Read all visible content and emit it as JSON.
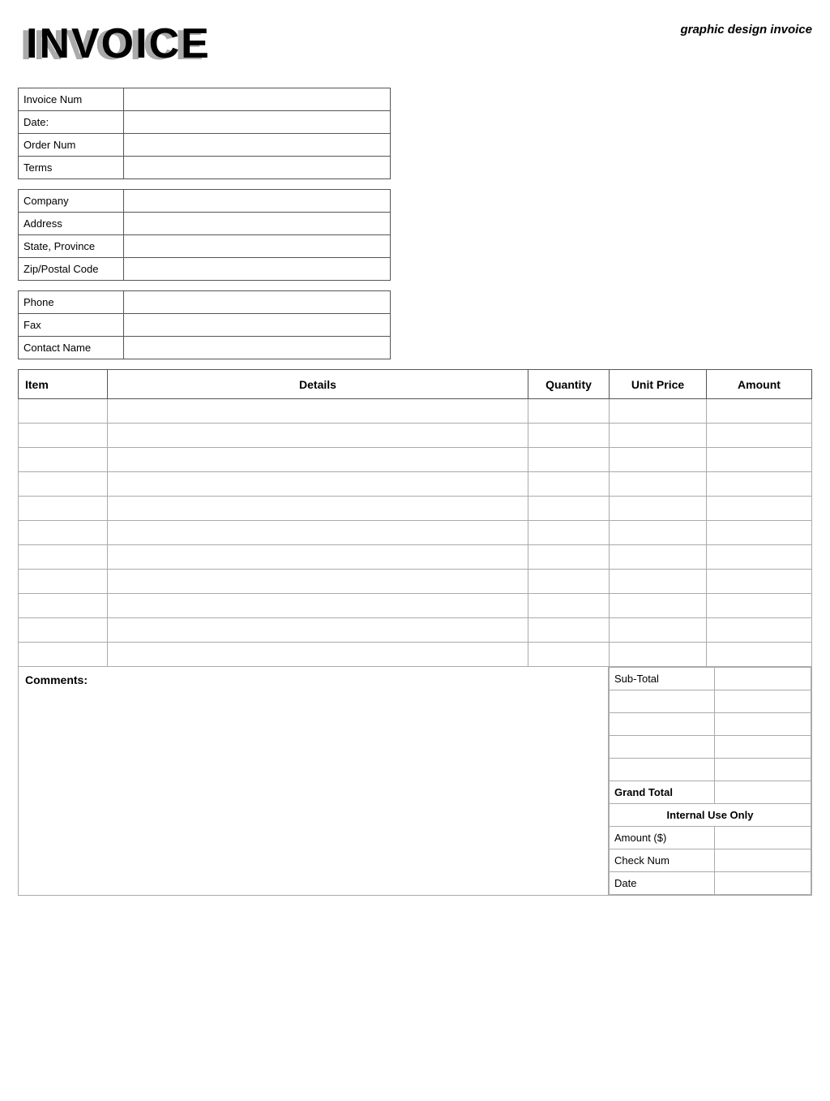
{
  "page": {
    "top_title": "graphic design invoice",
    "invoice_shadow": "INVOICE",
    "invoice_title": "INVOICE"
  },
  "invoice_info": {
    "rows": [
      {
        "label": "Invoice Num",
        "value": ""
      },
      {
        "label": "Date:",
        "value": ""
      },
      {
        "label": "Order Num",
        "value": ""
      },
      {
        "label": "Terms",
        "value": ""
      }
    ]
  },
  "company_info": {
    "rows": [
      {
        "label": "Company",
        "value": ""
      },
      {
        "label": "Address",
        "value": ""
      },
      {
        "label": "State, Province",
        "value": ""
      },
      {
        "label": "Zip/Postal Code",
        "value": ""
      }
    ]
  },
  "contact_info": {
    "rows": [
      {
        "label": "Phone",
        "value": ""
      },
      {
        "label": "Fax",
        "value": ""
      },
      {
        "label": "Contact Name",
        "value": ""
      }
    ]
  },
  "items_table": {
    "headers": {
      "item": "Item",
      "details": "Details",
      "quantity": "Quantity",
      "unit_price": "Unit Price",
      "amount": "Amount"
    },
    "rows": [
      {
        "item": "",
        "details": "",
        "quantity": "",
        "unit_price": "",
        "amount": ""
      },
      {
        "item": "",
        "details": "",
        "quantity": "",
        "unit_price": "",
        "amount": ""
      },
      {
        "item": "",
        "details": "",
        "quantity": "",
        "unit_price": "",
        "amount": ""
      },
      {
        "item": "",
        "details": "",
        "quantity": "",
        "unit_price": "",
        "amount": ""
      },
      {
        "item": "",
        "details": "",
        "quantity": "",
        "unit_price": "",
        "amount": ""
      },
      {
        "item": "",
        "details": "",
        "quantity": "",
        "unit_price": "",
        "amount": ""
      },
      {
        "item": "",
        "details": "",
        "quantity": "",
        "unit_price": "",
        "amount": ""
      },
      {
        "item": "",
        "details": "",
        "quantity": "",
        "unit_price": "",
        "amount": ""
      },
      {
        "item": "",
        "details": "",
        "quantity": "",
        "unit_price": "",
        "amount": ""
      },
      {
        "item": "",
        "details": "",
        "quantity": "",
        "unit_price": "",
        "amount": ""
      },
      {
        "item": "",
        "details": "",
        "quantity": "",
        "unit_price": "",
        "amount": ""
      }
    ]
  },
  "comments": {
    "label": "Comments:"
  },
  "totals": {
    "sub_total_label": "Sub-Total",
    "sub_total_value": "",
    "blank_rows": 4,
    "grand_total_label": "Grand Total",
    "grand_total_value": "",
    "internal_use_label": "Internal Use Only",
    "fields": [
      {
        "label": "Amount ($)",
        "value": ""
      },
      {
        "label": "Check Num",
        "value": ""
      },
      {
        "label": "Date",
        "value": ""
      }
    ]
  }
}
